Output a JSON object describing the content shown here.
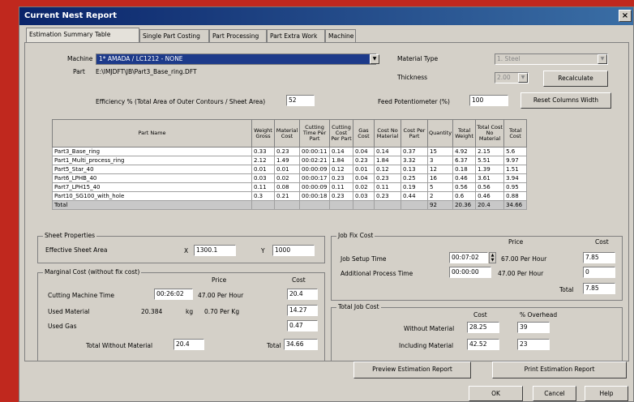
{
  "window": {
    "title": "Current Nest Report",
    "close_label": "×"
  },
  "tabs": [
    "Estimation Summary Table",
    "Single Part Costing",
    "Part Processing",
    "Part Extra Work",
    "Machine"
  ],
  "machine": {
    "label": "Machine",
    "value": "1* AMADA / LC1212 - NONE"
  },
  "part": {
    "label": "Part",
    "value": "E:\\IMJDFT\\JB\\Part3_Base_ring.DFT"
  },
  "material_type": {
    "label": "Material Type",
    "value": "1. Steel"
  },
  "thickness": {
    "label": "Thickness",
    "value": "2.00"
  },
  "recalculate_label": "Recalculate",
  "efficiency": {
    "label": "Efficiency % (Total Area of Outer Contours / Sheet Area)",
    "value": "52"
  },
  "feed": {
    "label": "Feed Potentiometer (%)",
    "value": "100"
  },
  "reset_columns_label": "Reset Columns Width",
  "table": {
    "headers": [
      "Part Name",
      "Weight Gross",
      "Material Cost",
      "Cutting Time Per Part",
      "Cutting Cost Per Part",
      "Gas Cost",
      "Cost No Material",
      "Cost Per Part",
      "Quantity",
      "Total Weight",
      "Total Cost No Material",
      "Total Cost"
    ],
    "rows": [
      [
        "Part3_Base_ring",
        "0.33",
        "0.23",
        "00:00:11",
        "0.14",
        "0.04",
        "0.14",
        "0.37",
        "15",
        "4.92",
        "2.15",
        "5.6"
      ],
      [
        "Part1_Multi_process_ring",
        "2.12",
        "1.49",
        "00:02:21",
        "1.84",
        "0.23",
        "1.84",
        "3.32",
        "3",
        "6.37",
        "5.51",
        "9.97"
      ],
      [
        "Part5_Star_40",
        "0.01",
        "0.01",
        "00:00:09",
        "0.12",
        "0.01",
        "0.12",
        "0.13",
        "12",
        "0.18",
        "1.39",
        "1.51"
      ],
      [
        "Part6_LPHB_40",
        "0.03",
        "0.02",
        "00:00:17",
        "0.23",
        "0.04",
        "0.23",
        "0.25",
        "16",
        "0.46",
        "3.61",
        "3.94"
      ],
      [
        "Part7_LPH15_40",
        "0.11",
        "0.08",
        "00:00:09",
        "0.11",
        "0.02",
        "0.11",
        "0.19",
        "5",
        "0.56",
        "0.56",
        "0.95"
      ],
      [
        "Part10_SG100_with_hole",
        "0.3",
        "0.21",
        "00:00:18",
        "0.23",
        "0.03",
        "0.23",
        "0.44",
        "2",
        "0.6",
        "0.46",
        "0.88"
      ]
    ],
    "total": [
      "Total",
      "",
      "",
      "",
      "",
      "",
      "",
      "",
      "92",
      "20.36",
      "20.4",
      "34.66"
    ]
  },
  "sheet": {
    "title": "Sheet Properties",
    "area_label": "Effective Sheet Area",
    "x_label": "X",
    "x_value": "1300.1",
    "y_label": "Y",
    "y_value": "1000"
  },
  "marginal": {
    "title": "Marginal Cost (without fix cost)",
    "price_header": "Price",
    "cost_header": "Cost",
    "cutting_label": "Cutting Machine Time",
    "cutting_time": "00:26:02",
    "cutting_price": "47.00 Per Hour",
    "cutting_cost": "20.4",
    "material_label": "Used Material",
    "material_qty": "20.384",
    "material_unit": "kg",
    "material_price": "0.70 Per Kg",
    "material_cost": "14.27",
    "gas_label": "Used Gas",
    "gas_cost": "0.47",
    "total_wo_label": "Total Without Material",
    "total_wo_value": "20.4",
    "total_label": "Total",
    "total_value": "34.66"
  },
  "jobfix": {
    "title": "Job Fix Cost",
    "price_header": "Price",
    "cost_header": "Cost",
    "setup_label": "Job Setup Time",
    "setup_time": "00:07:02",
    "setup_price": "67.00 Per Hour",
    "setup_cost": "7.85",
    "addl_label": "Additional Process Time",
    "addl_time": "00:00:00",
    "addl_price": "47.00 Per Hour",
    "addl_cost": "0",
    "total_label": "Total",
    "total_value": "7.85"
  },
  "totaljob": {
    "title": "Total Job Cost",
    "cost_header": "Cost",
    "overhead_header": "% Overhead",
    "without_label": "Without Material",
    "without_cost": "28.25",
    "without_oh": "39",
    "including_label": "Including Material",
    "including_cost": "42.52",
    "including_oh": "23"
  },
  "buttons": {
    "preview": "Preview Estimation Report",
    "print": "Print Estimation Report",
    "ok": "OK",
    "cancel": "Cancel",
    "help": "Help"
  }
}
